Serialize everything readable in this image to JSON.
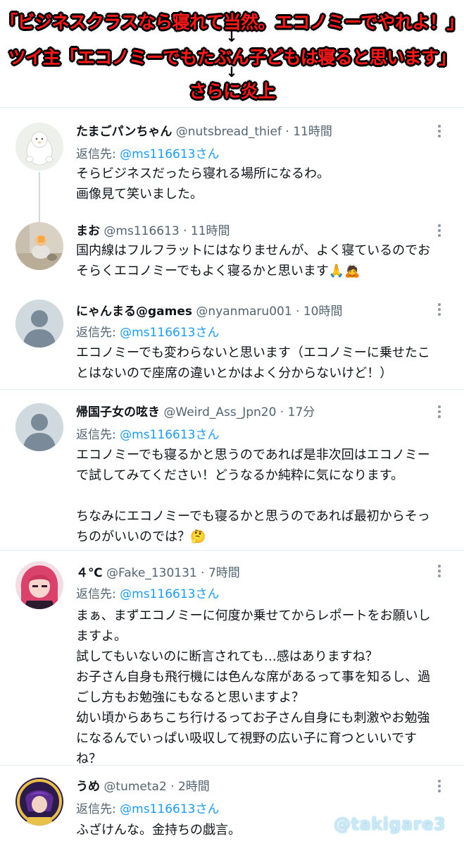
{
  "header": {
    "line1": "「ビジネスクラスなら寝れて当然。エコノミーでやれよ！」",
    "arrow": "↓",
    "line2": "ツイ主「エコノミーでもたぶん子どもは寝ると思います」",
    "line3": "さらに炎上"
  },
  "tweets": [
    {
      "name": "たまごパンちゃん",
      "meta": "@nutsbread_thief · 11時間",
      "reply_prefix": "返信先: ",
      "reply_to": "@ms116613さん",
      "text": "そらビジネスだったら寝れる場所になるわ。\n画像見て笑いました。"
    },
    {
      "name": "まお",
      "meta": "@ms116613 · 11時間",
      "text": "国内線はフルフラットにはなりませんが、よく寝ているのでお\nそらくエコノミーでもよく寝るかと思います🙏🙇"
    },
    {
      "name": "にゃんまる@games",
      "meta": "@nyanmaru001 · 10時間",
      "reply_prefix": "返信先: ",
      "reply_to": "@ms116613さん",
      "text": "エコノミーでも変わらないと思います（エコノミーに乗せたこ\nとはないので座席の違いとかはよく分からないけど！）"
    },
    {
      "name": "帰国子女の呟き",
      "meta": "@Weird_Ass_Jpn20 · 17分",
      "reply_prefix": "返信先: ",
      "reply_to": "@ms116613さん",
      "text": "エコノミーでも寝るかと思うのであれば是非次回はエコノミー\nで試してみてください！どうなるか純粋に気になります。\n\nちなみにエコノミーでも寝るかと思うのであれば最初からそっ\nちのがいいのでは？🤔"
    },
    {
      "name": "４℃",
      "meta": "@Fake_130131 · 7時間",
      "reply_prefix": "返信先: ",
      "reply_to": "@ms116613さん",
      "text": "まぁ、まずエコノミーに何度か乗せてからレポートをお願いし\nますよ。\n試してもいないのに断言されても…感はありますね？\nお子さん自身も飛行機には色んな席があるって事を知るし、過\nごし方もお勉強にもなると思いますよ？\n幼い頃からあちこち行けるってお子さん自身にも刺激やお勉強\nになるんでいっぱい吸収して視野の広い子に育つといいです\nね？"
    },
    {
      "name": "うめ",
      "meta": "@tumeta2 · 2時間",
      "reply_prefix": "返信先: ",
      "reply_to": "@ms116613さん",
      "text": "ふざけんな。金持ちの戯言。"
    }
  ],
  "watermark": "@takigare3",
  "colors": {
    "caption_red": "#ff1a1a",
    "handle_gray": "#536471",
    "mention_blue": "#1d9bf0",
    "divider": "#e6ecf0"
  },
  "icons": [
    "more-options-icon",
    "default-avatar-silhouette"
  ]
}
